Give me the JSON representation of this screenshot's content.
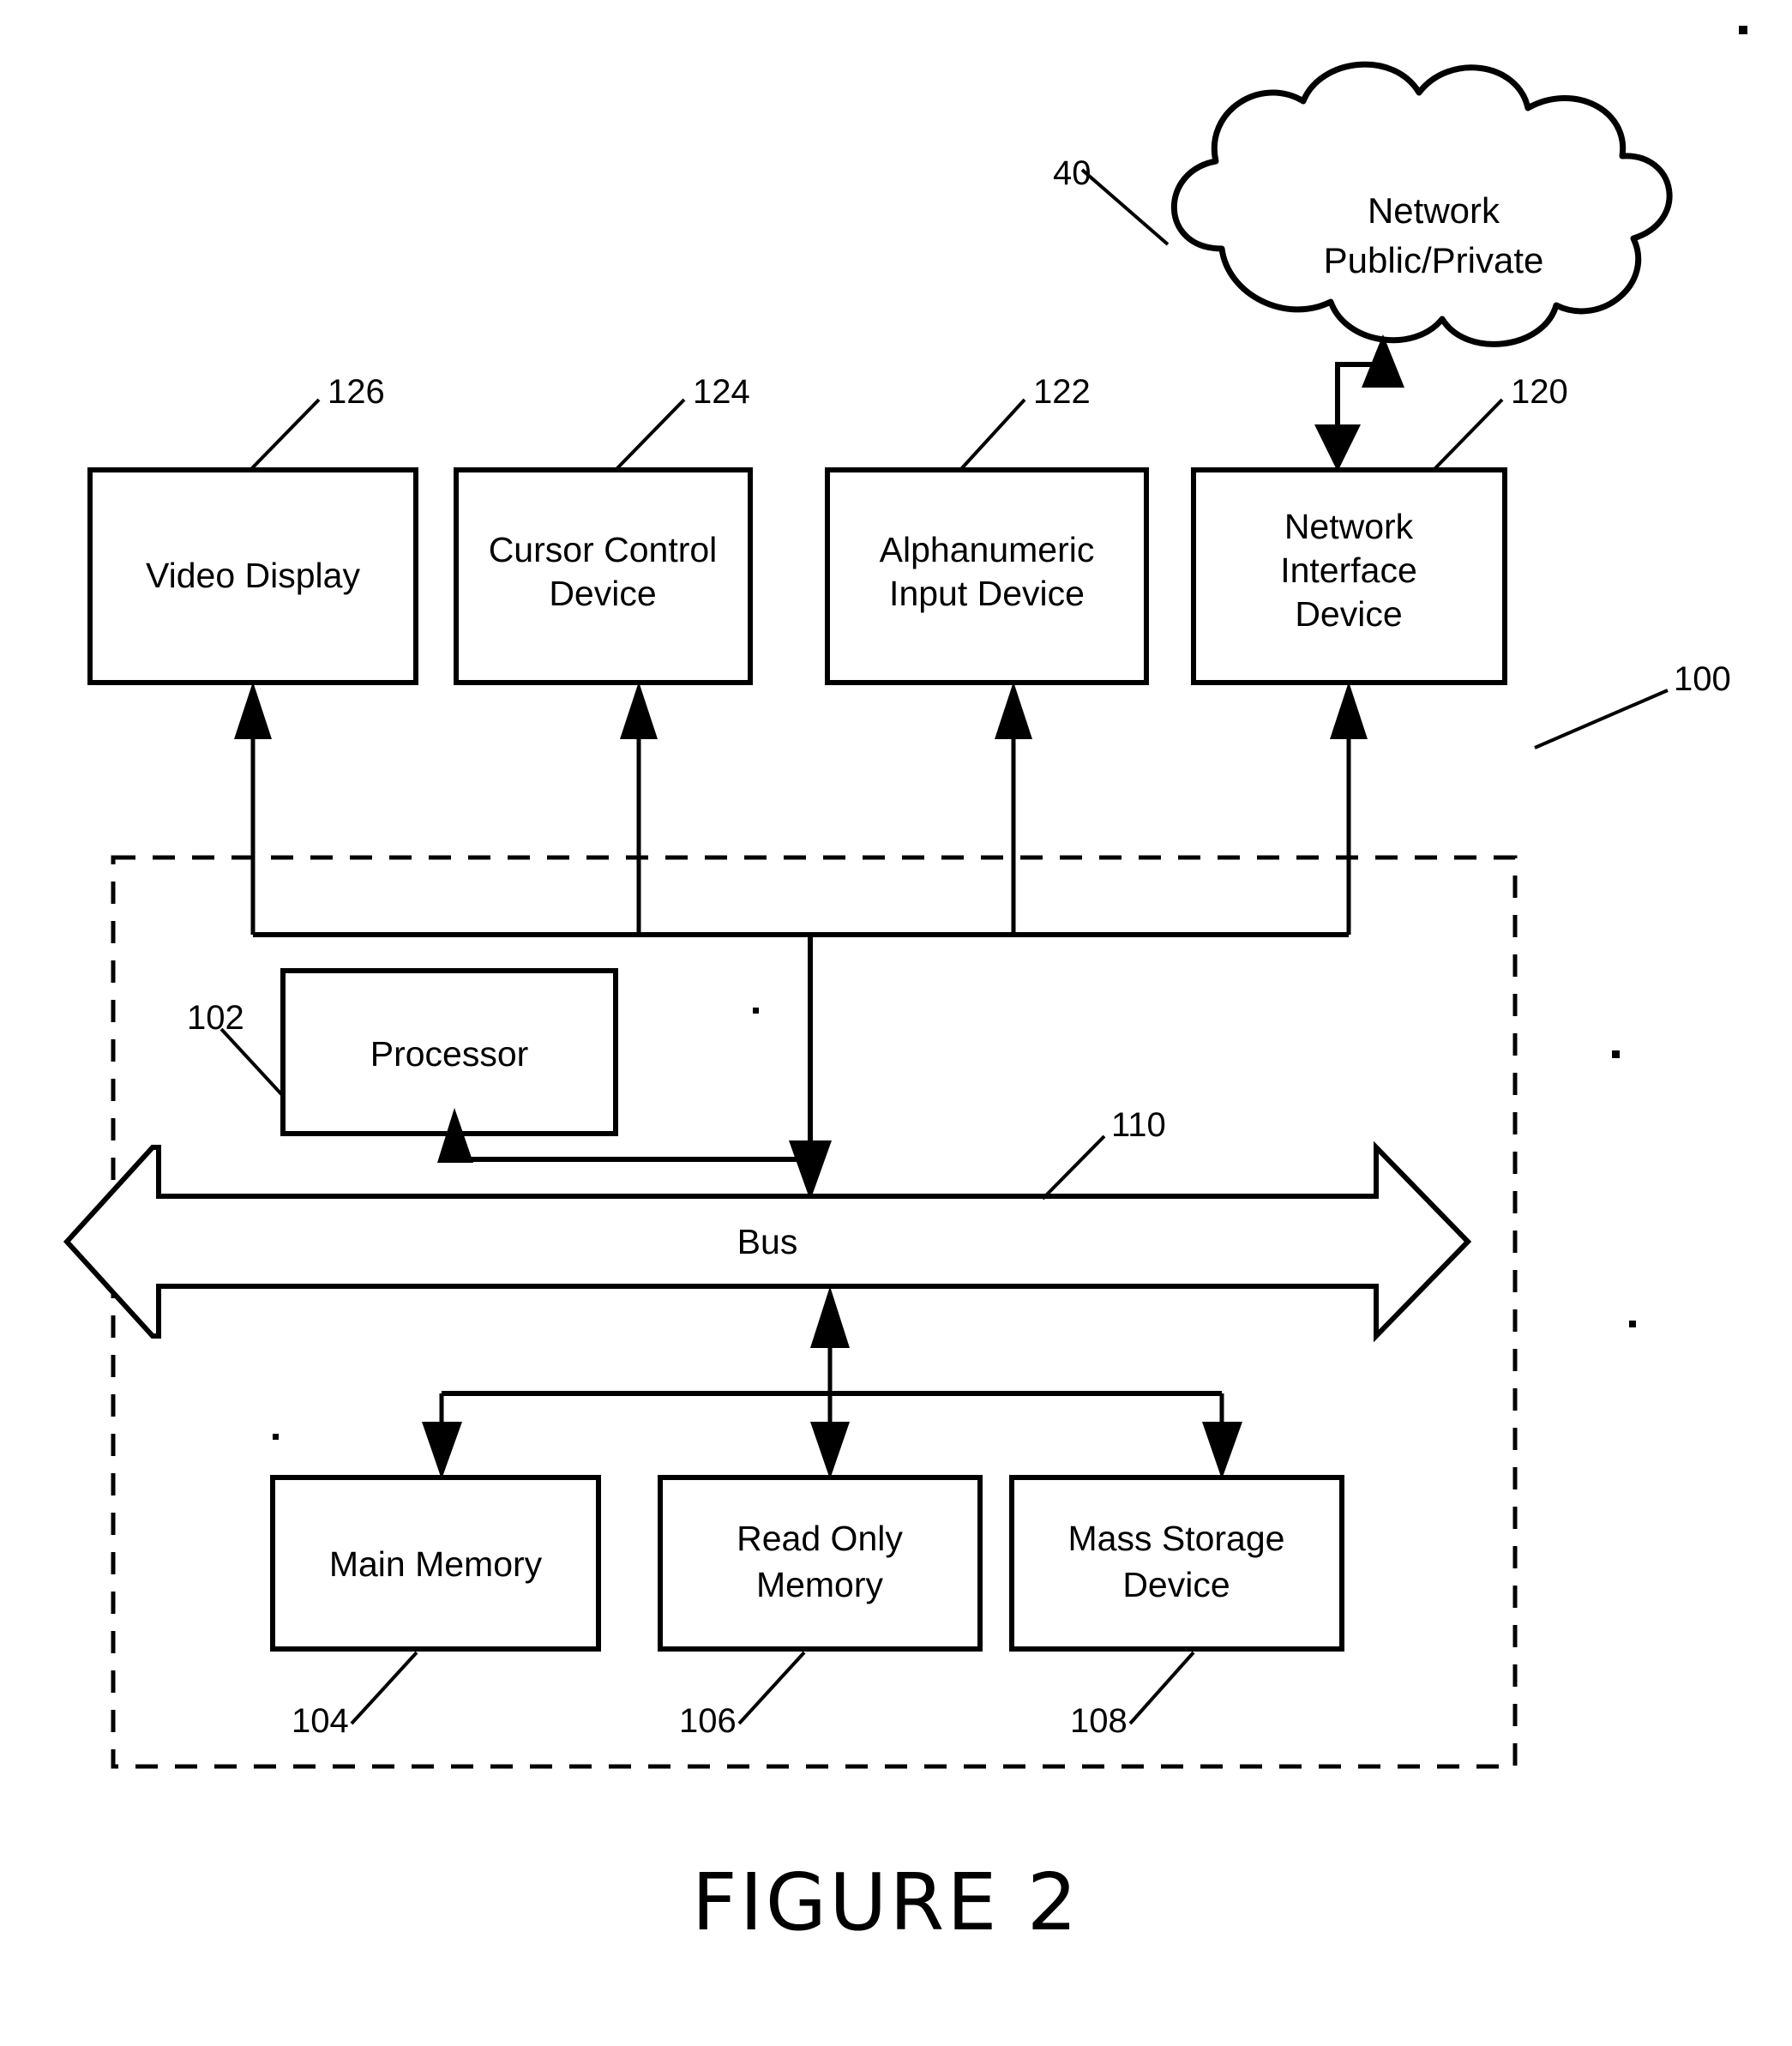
{
  "figure": {
    "caption": "FIGURE 2",
    "system_ref": "100"
  },
  "cloud": {
    "label_line1": "Network",
    "label_line2": "Public/Private",
    "ref": "40"
  },
  "peripherals": [
    {
      "name": "video-display",
      "label_line1": "Video Display",
      "label_line2": "",
      "ref": "126"
    },
    {
      "name": "cursor-control-device",
      "label_line1": "Cursor Control",
      "label_line2": "Device",
      "ref": "124"
    },
    {
      "name": "alphanumeric-input-device",
      "label_line1": "Alphanumeric",
      "label_line2": "Input Device",
      "ref": "122"
    },
    {
      "name": "network-interface-device",
      "label_line1": "Network",
      "label_line2": "Interface",
      "label_line3": "Device",
      "ref": "120"
    }
  ],
  "processor": {
    "label": "Processor",
    "ref": "102"
  },
  "bus": {
    "label": "Bus",
    "ref": "110"
  },
  "memories": [
    {
      "name": "main-memory",
      "label_line1": "Main Memory",
      "label_line2": "",
      "ref": "104"
    },
    {
      "name": "read-only-memory",
      "label_line1": "Read Only",
      "label_line2": "Memory",
      "ref": "106"
    },
    {
      "name": "mass-storage-device",
      "label_line1": "Mass Storage",
      "label_line2": "Device",
      "ref": "108"
    }
  ],
  "colors": {
    "ink": "#000000",
    "paper": "#ffffff"
  }
}
